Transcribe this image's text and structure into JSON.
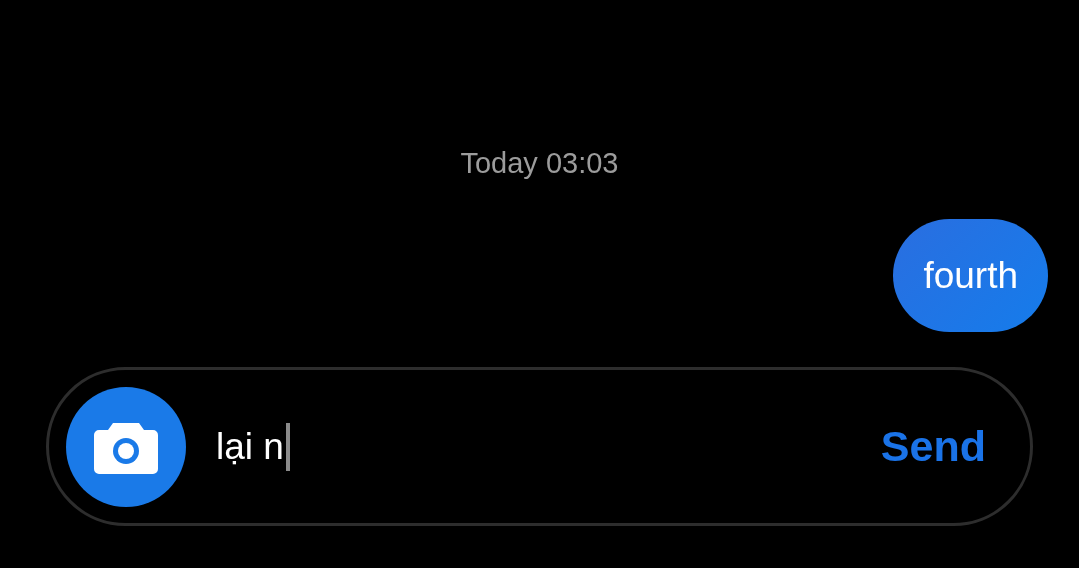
{
  "timestamp": "Today 03:03",
  "messages": [
    {
      "text": "fourth",
      "outgoing": true
    }
  ],
  "composer": {
    "value": "lại n",
    "send_label": "Send"
  }
}
